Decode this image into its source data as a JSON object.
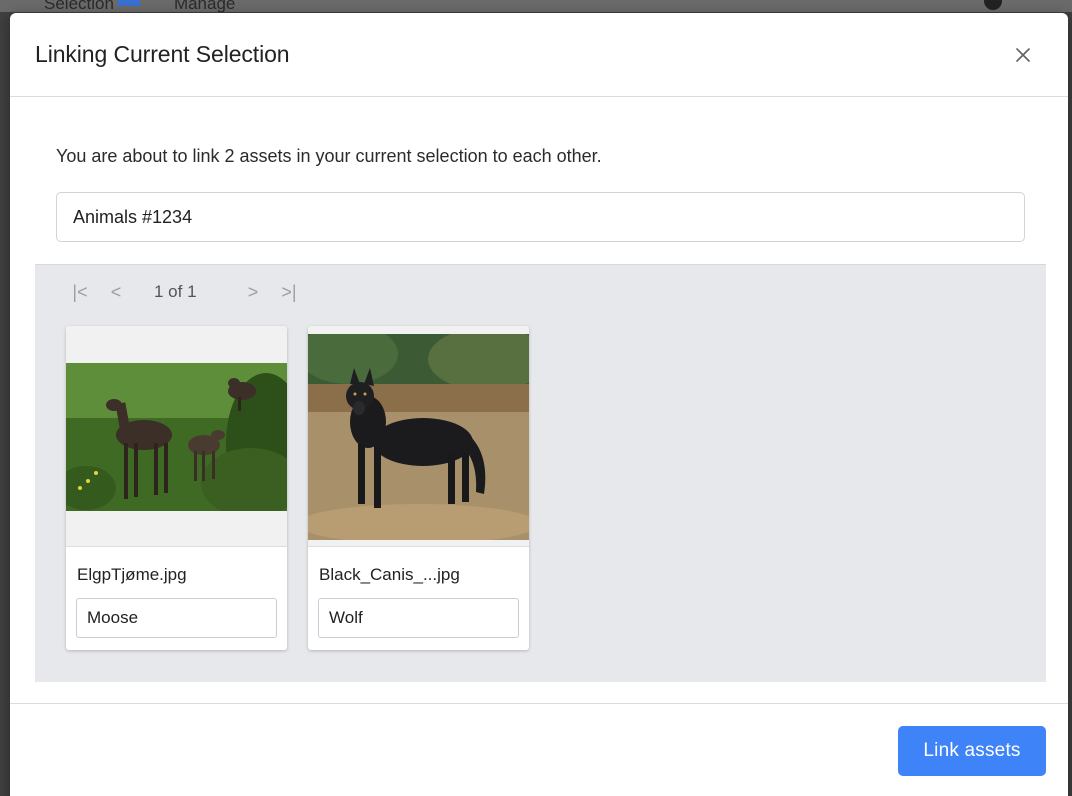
{
  "background": {
    "tabs": [
      "Selection",
      "Manage"
    ]
  },
  "modal": {
    "title": "Linking Current Selection",
    "intro": "You are about to link 2 assets in your current selection to each other.",
    "name_value": "Animals #1234",
    "pager": {
      "first": "|<",
      "prev": "<",
      "status": "1 of 1",
      "next": ">",
      "last": ">|"
    },
    "assets": [
      {
        "filename": "ElgpTjøme.jpg",
        "label_value": "Moose",
        "thumbnail": "moose-photo"
      },
      {
        "filename": "Black_Canis_...jpg",
        "label_value": "Wolf",
        "thumbnail": "wolf-photo"
      }
    ],
    "link_button": "Link assets"
  },
  "colors": {
    "accent": "#3e83f8",
    "panel": "#e6e8eb"
  }
}
